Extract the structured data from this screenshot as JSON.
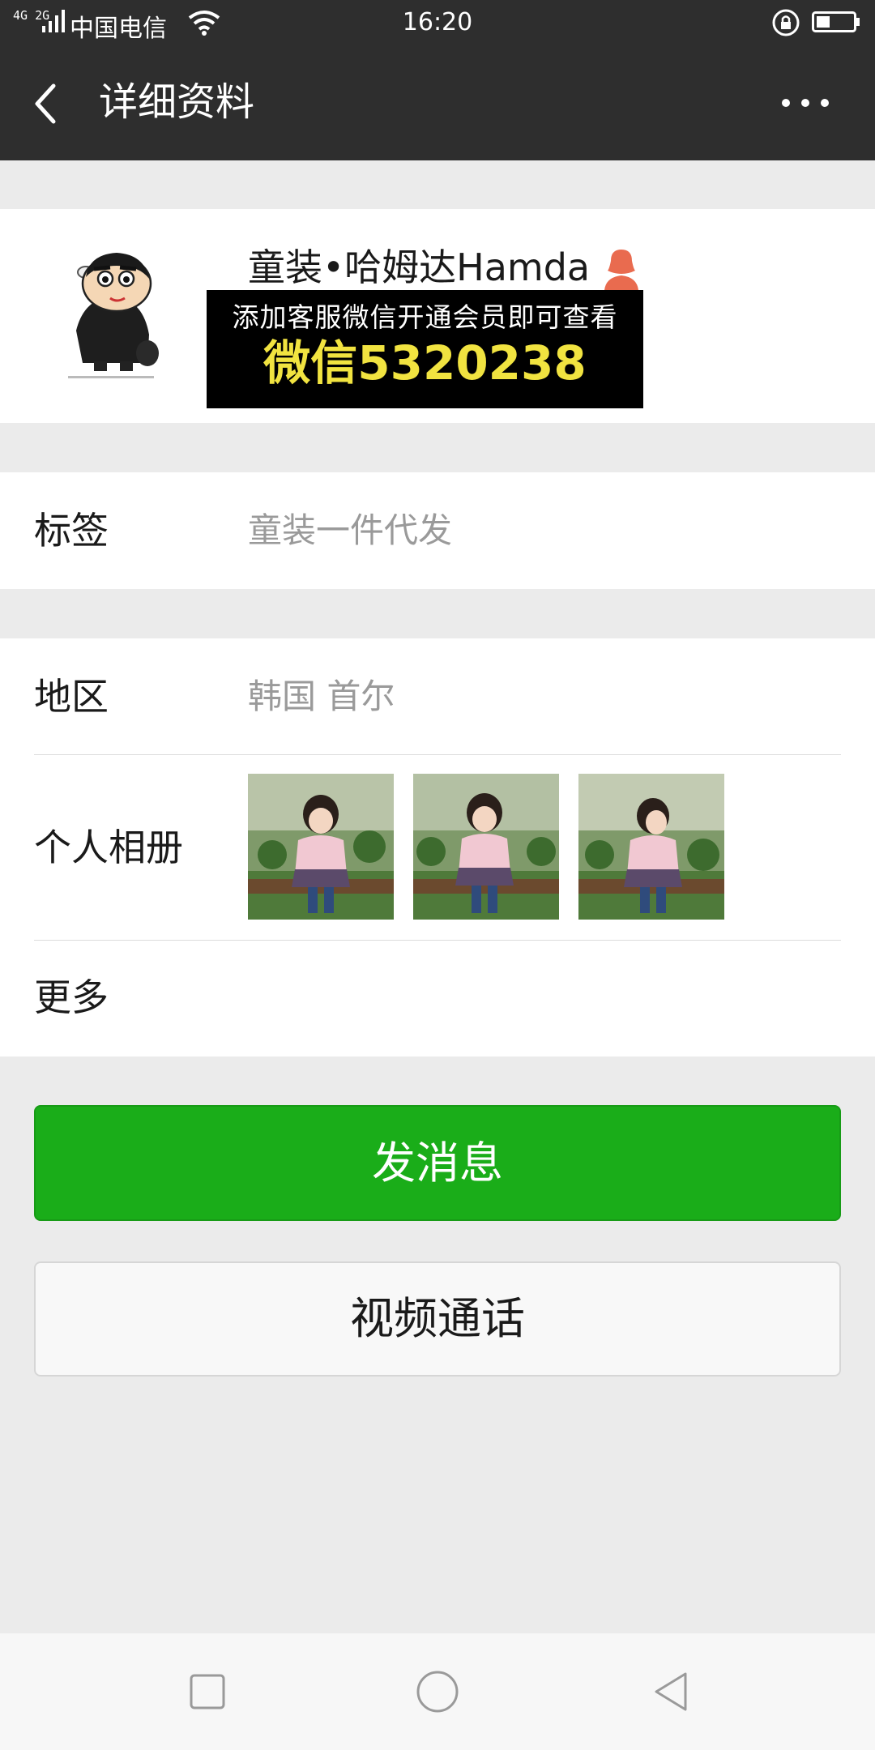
{
  "status_bar": {
    "network": "4G 2G",
    "carrier": "中国电信",
    "time": "16:20",
    "icons": [
      "signal-icon",
      "wifi-icon",
      "rotation-lock-icon",
      "battery-icon"
    ]
  },
  "nav": {
    "title": "详细资料",
    "back_icon": "back-arrow-icon",
    "more_icon": "more-icon"
  },
  "profile": {
    "name": "童装•哈姆达Hamda",
    "gender_icon": "female-icon",
    "promo_line1": "添加客服微信开通会员即可查看",
    "promo_line2": "微信5320238"
  },
  "rows": {
    "tags_label": "标签",
    "tags_value": "童装一件代发",
    "region_label": "地区",
    "region_value": "韩国  首尔",
    "album_label": "个人相册",
    "more_label": "更多"
  },
  "album": {
    "photos": [
      "album-photo-1",
      "album-photo-2",
      "album-photo-3"
    ]
  },
  "buttons": {
    "send_message": "发消息",
    "video_call": "视频通话"
  },
  "colors": {
    "header": "#2e2e2e",
    "primary_green": "#1aad19",
    "promo_yellow": "#f1e340",
    "background": "#ebebeb"
  },
  "system_nav": [
    "recent-apps-icon",
    "home-icon",
    "back-icon"
  ]
}
